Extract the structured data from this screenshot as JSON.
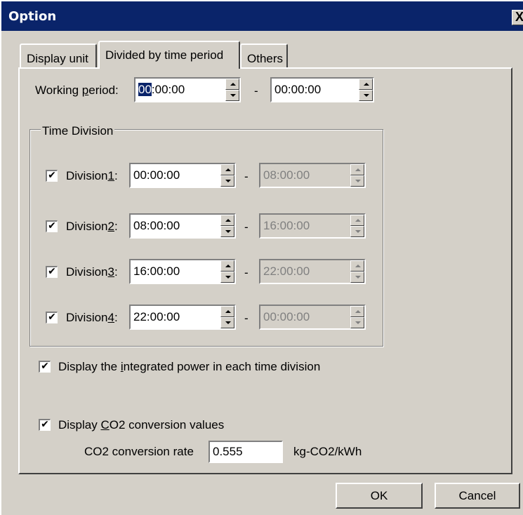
{
  "window": {
    "title": "Option",
    "close_glyph": "X"
  },
  "tabs": [
    {
      "label": "Display unit",
      "active": false
    },
    {
      "label": "Divided by time period",
      "active": true
    },
    {
      "label": "Others",
      "active": false
    }
  ],
  "working_period": {
    "label_pre": "Working ",
    "label_key": "p",
    "label_post": "eriod:",
    "start_selected": "00",
    "start_rest": ":00:00",
    "end": "00:00:00"
  },
  "time_division": {
    "legend": "Time Division",
    "separator": "-",
    "items": [
      {
        "label_pre": "Division",
        "label_key": "1",
        "label_post": ":",
        "checked": true,
        "start": "00:00:00",
        "end": "08:00:00"
      },
      {
        "label_pre": "Division",
        "label_key": "2",
        "label_post": ":",
        "checked": true,
        "start": "08:00:00",
        "end": "16:00:00"
      },
      {
        "label_pre": "Division",
        "label_key": "3",
        "label_post": ":",
        "checked": true,
        "start": "16:00:00",
        "end": "22:00:00"
      },
      {
        "label_pre": "Division",
        "label_key": "4",
        "label_post": ":",
        "checked": true,
        "start": "22:00:00",
        "end": "00:00:00"
      }
    ]
  },
  "integrated_power": {
    "label_pre": "Display the ",
    "label_key": "i",
    "label_post": "ntegrated power in each time division",
    "checked": true
  },
  "co2": {
    "label_pre": "Display ",
    "label_key": "C",
    "label_post": "O2 conversion values",
    "checked": true,
    "rate_label": "CO2 conversion rate",
    "rate_value": "0.555",
    "unit": "kg-CO2/kWh"
  },
  "check_glyph": "✔",
  "buttons": {
    "ok": "OK",
    "cancel": "Cancel"
  },
  "colors": {
    "face": "#d4d0c8",
    "title_bar": "#0a246a",
    "selection": "#0a246a",
    "disabled_text": "#808080"
  }
}
